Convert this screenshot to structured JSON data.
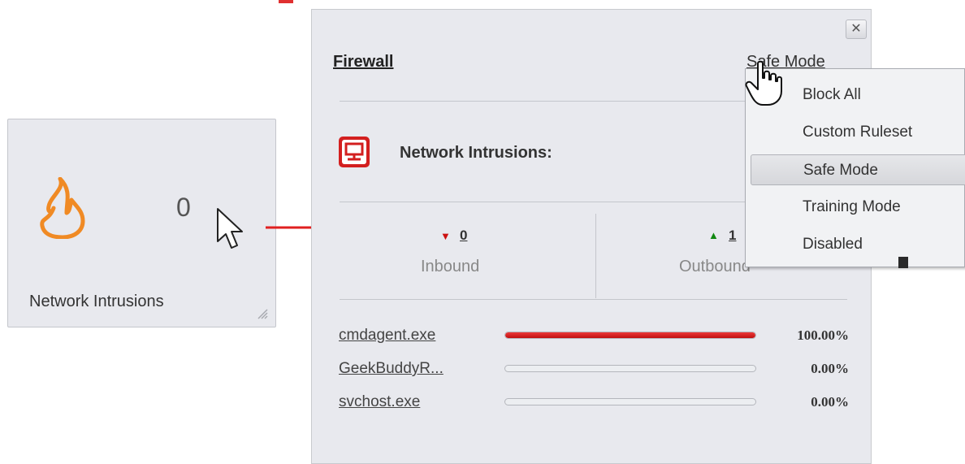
{
  "widget": {
    "count": "0",
    "caption": "Network Intrusions"
  },
  "panel": {
    "title": "Firewall",
    "mode_link": "Safe Mode",
    "close_glyph": "✕",
    "intrusions_label": "Network Intrusions:",
    "inbound": {
      "value": "0",
      "label": "Inbound",
      "color": "#cc1111"
    },
    "outbound": {
      "value": "1",
      "label": "Outbound",
      "color": "#118811"
    },
    "processes": [
      {
        "name": "cmdagent.exe",
        "percent": "100.00%",
        "fill": 1.0
      },
      {
        "name": "GeekBuddyR...",
        "percent": "0.00%",
        "fill": 0.0
      },
      {
        "name": "svchost.exe",
        "percent": "0.00%",
        "fill": 0.0
      }
    ]
  },
  "menu": {
    "items": [
      "Block All",
      "Custom Ruleset",
      "Safe Mode",
      "Training Mode",
      "Disabled"
    ],
    "selected": "Safe Mode"
  },
  "icons": {
    "widget": "flame-icon",
    "intrusions": "monitor-icon",
    "cursor": "mouse-pointer-icon",
    "hand": "hand-pointer-icon"
  },
  "colors": {
    "accent": "#e03030",
    "flame": "#f08a24"
  }
}
